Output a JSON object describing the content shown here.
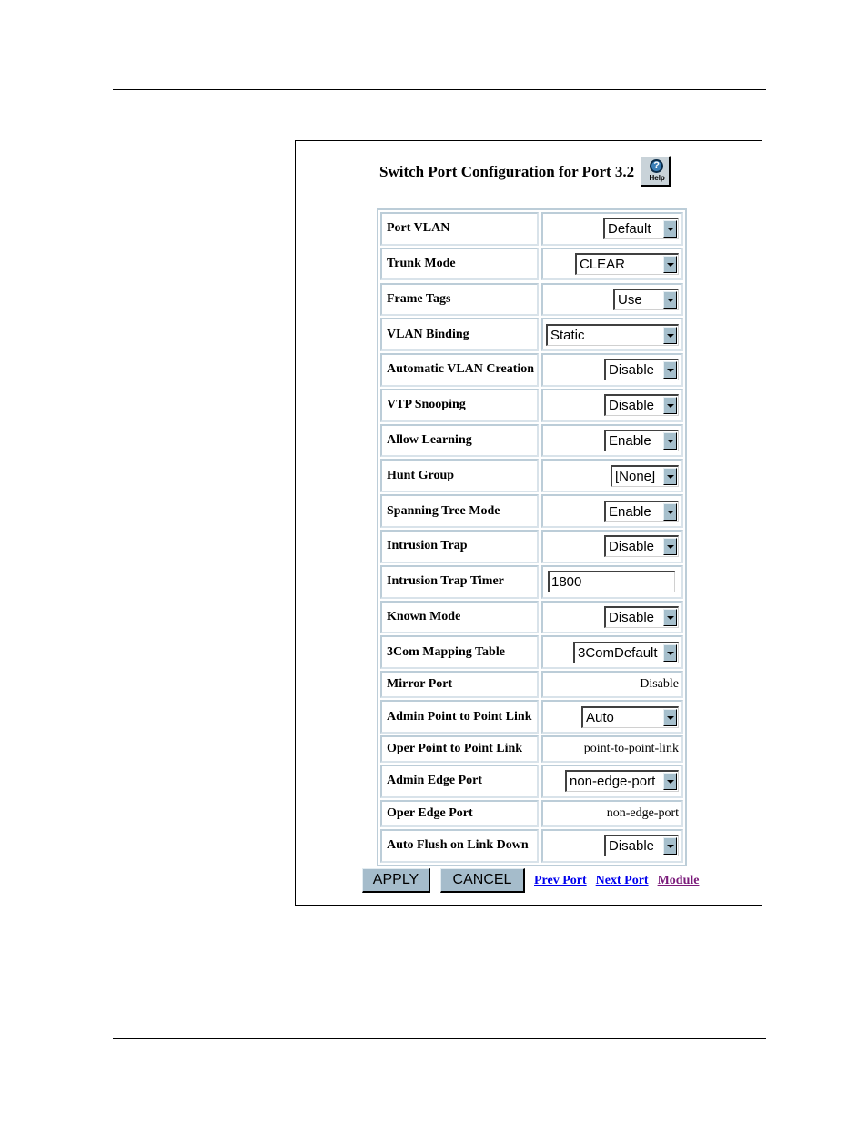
{
  "page": {
    "title": "Switch Port Configuration for Port 3.2",
    "help_icon": "help-question-icon",
    "help_label": "Help"
  },
  "rows": [
    {
      "label": "Port VLAN",
      "type": "select",
      "value": "Default"
    },
    {
      "label": "Trunk Mode",
      "type": "select",
      "value": "CLEAR"
    },
    {
      "label": "Frame Tags",
      "type": "select",
      "value": "Use"
    },
    {
      "label": "VLAN Binding",
      "type": "select",
      "value": "Static"
    },
    {
      "label": "Automatic VLAN Creation",
      "type": "select",
      "value": "Disable"
    },
    {
      "label": "VTP Snooping",
      "type": "select",
      "value": "Disable"
    },
    {
      "label": "Allow Learning",
      "type": "select",
      "value": "Enable"
    },
    {
      "label": "Hunt Group",
      "type": "select",
      "value": "[None]"
    },
    {
      "label": "Spanning Tree Mode",
      "type": "select",
      "value": "Enable"
    },
    {
      "label": "Intrusion Trap",
      "type": "select",
      "value": "Disable"
    },
    {
      "label": "Intrusion Trap Timer",
      "type": "input",
      "value": "1800"
    },
    {
      "label": "Known Mode",
      "type": "select",
      "value": "Disable"
    },
    {
      "label": "3Com Mapping Table",
      "type": "select",
      "value": "3ComDefault"
    },
    {
      "label": "Mirror Port",
      "type": "static",
      "value": "Disable"
    },
    {
      "label": "Admin Point to Point Link",
      "type": "select",
      "value": "Auto"
    },
    {
      "label": "Oper Point to Point Link",
      "type": "static",
      "value": "point-to-point-link"
    },
    {
      "label": "Admin Edge Port",
      "type": "select",
      "value": "non-edge-port"
    },
    {
      "label": "Oper Edge Port",
      "type": "static",
      "value": "non-edge-port"
    },
    {
      "label": "Auto Flush on Link Down",
      "type": "select",
      "value": "Disable"
    }
  ],
  "actions": {
    "apply_label": "APPLY",
    "cancel_label": "CANCEL",
    "prev_port_label": "Prev Port",
    "next_port_label": "Next Port",
    "module_label": "Module"
  },
  "colors": {
    "link": "#0000ee",
    "visited_link": "#7a1a7a",
    "button_face": "#a5bccb",
    "table_border": "#bccdd8"
  }
}
